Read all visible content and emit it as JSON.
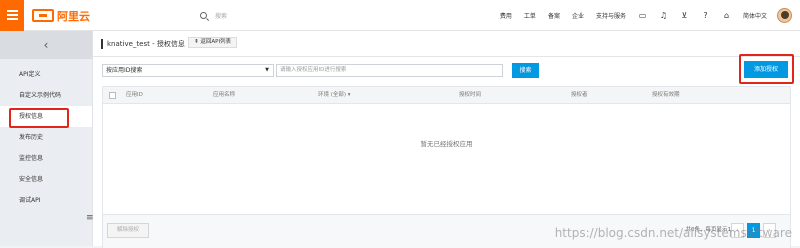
{
  "header": {
    "logo_text": "阿里云",
    "search_placeholder": "搜索",
    "nav": [
      "费用",
      "工单",
      "备案",
      "企业",
      "支持与服务"
    ],
    "language": "简体中文",
    "icons": [
      "terminal-icon",
      "bell-icon",
      "cart-icon",
      "help-icon",
      "home-icon"
    ]
  },
  "sidebar": {
    "back_icon": "‹",
    "items": [
      {
        "label": "API定义"
      },
      {
        "label": "自定义示例代码"
      },
      {
        "label": "授权信息"
      },
      {
        "label": "发布历史"
      },
      {
        "label": "监控信息"
      },
      {
        "label": "安全信息"
      },
      {
        "label": "调试API"
      }
    ],
    "active_index": 2
  },
  "main": {
    "title": "knative_test - 授权信息",
    "back_button": "返回API列表",
    "filter_select": "按应用ID搜索",
    "search_placeholder": "请输入授权应用ID进行搜索",
    "search_button": "搜索",
    "add_button": "添加授权",
    "columns": [
      "应用ID",
      "应用名称",
      "环境 (全部) ▾",
      "授权时间",
      "授权者",
      "授权有效期"
    ],
    "empty_text": "暂无已经授权应用",
    "cancel_button": "解除授权",
    "page_info": "共0条，每页显示10条",
    "pagination": {
      "prev": "‹",
      "current": "1",
      "next": "›"
    }
  },
  "watermark": "https://blog.csdn.net/alisystemsoftware",
  "colors": {
    "accent": "#0099e2",
    "brand": "#ff6a00",
    "highlight": "#e1251b"
  }
}
